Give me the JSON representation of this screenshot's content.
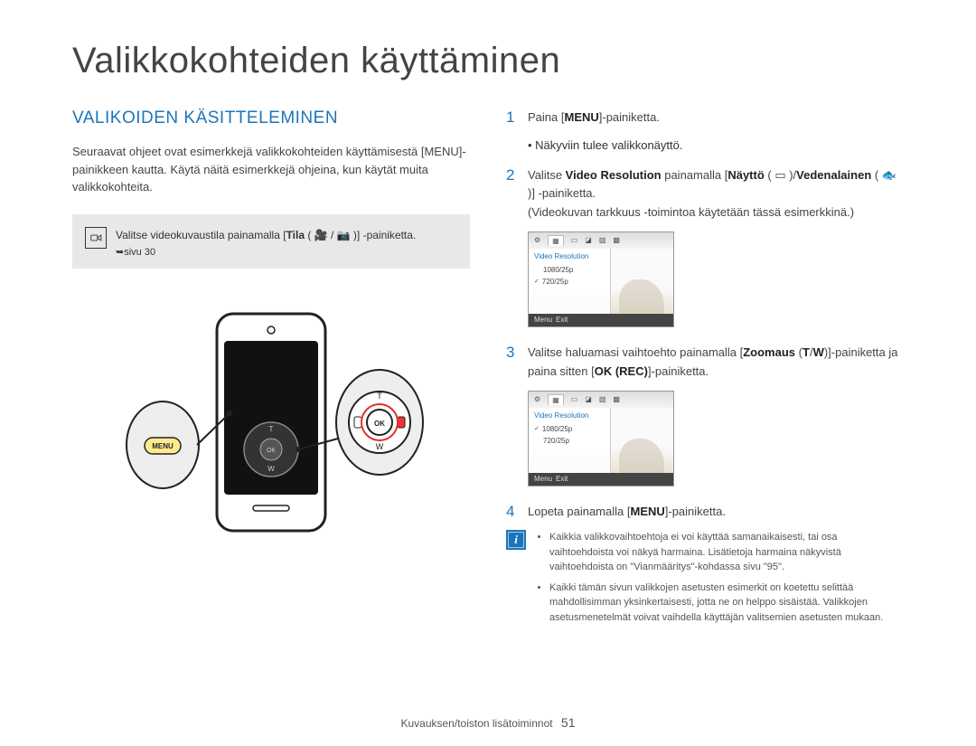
{
  "page_title": "Valikkokohteiden käyttäminen",
  "section_heading": "VALIKOIDEN KÄSITTELEMINEN",
  "intro_text": "Seuraavat ohjeet ovat esimerkkejä valikkokohteiden käyttämisestä [MENU]-painikkeen kautta. Käytä näitä esimerkkejä ohjeina, kun käytät muita valikkokohteita.",
  "callout": {
    "line1_pre": "Valitse videokuvaustila painamalla [",
    "line1_bold": "Tila",
    "line1_post": " ( 🎥 / 📷 )] -painiketta.",
    "ref": "➥sivu 30"
  },
  "steps": {
    "s1": {
      "num": "1",
      "text_pre": "Paina [",
      "text_bold": "MENU",
      "text_post": "]-painiketta.",
      "sub_bullet": "• Näkyviin tulee valikkonäyttö."
    },
    "s2": {
      "num": "2",
      "t1": "Valitse ",
      "b1": "Video Resolution",
      "t2": " painamalla [",
      "b2": "Näyttö",
      "t3": " ( ▭ )/",
      "b3": "Vedenalainen",
      "t4": " ( 🐟 )] -painiketta.",
      "tail": "(Videokuvan tarkkuus -toimintoa käytetään tässä esimerkkinä.)"
    },
    "s3": {
      "num": "3",
      "t1": "Valitse haluamasi vaihtoehto painamalla [",
      "b1": "Zoomaus",
      "t2": " (",
      "b2": "T",
      "t3": "/",
      "b3": "W",
      "t4": ")]-painiketta ja paina sitten [",
      "b4": "OK (REC)",
      "t5": "]-painiketta."
    },
    "s4": {
      "num": "4",
      "t1": "Lopeta painamalla [",
      "b1": "MENU",
      "t2": "]-painiketta."
    }
  },
  "screen": {
    "menu_header": "Video Resolution",
    "item1": "1080/25p",
    "item2": "720/25p",
    "exit_label": "Exit",
    "menu_tag": "Menu"
  },
  "notes": {
    "n1": "Kaikkia valikkovaihtoehtoja ei voi käyttää samanaikaisesti, tai osa vaihtoehdoista voi näkyä harmaina. Lisätietoja harmaina näkyvistä vaihtoehdoista on \"Vianmääritys\"-kohdassa sivu \"95\".",
    "n2": "Kaikki tämän sivun valikkojen asetusten esimerkit on koetettu selittää mahdollisimman yksinkertaisesti, jotta ne on helppo sisäistää. Valikkojen asetusmenetelmät voivat vaihdella käyttäjän valitsemien asetusten mukaan."
  },
  "footer": {
    "section": "Kuvauksen/toiston lisätoiminnot",
    "page": "51"
  },
  "device": {
    "menu_label": "MENU",
    "ok_label": "OK",
    "t_label": "T",
    "w_label": "W"
  }
}
